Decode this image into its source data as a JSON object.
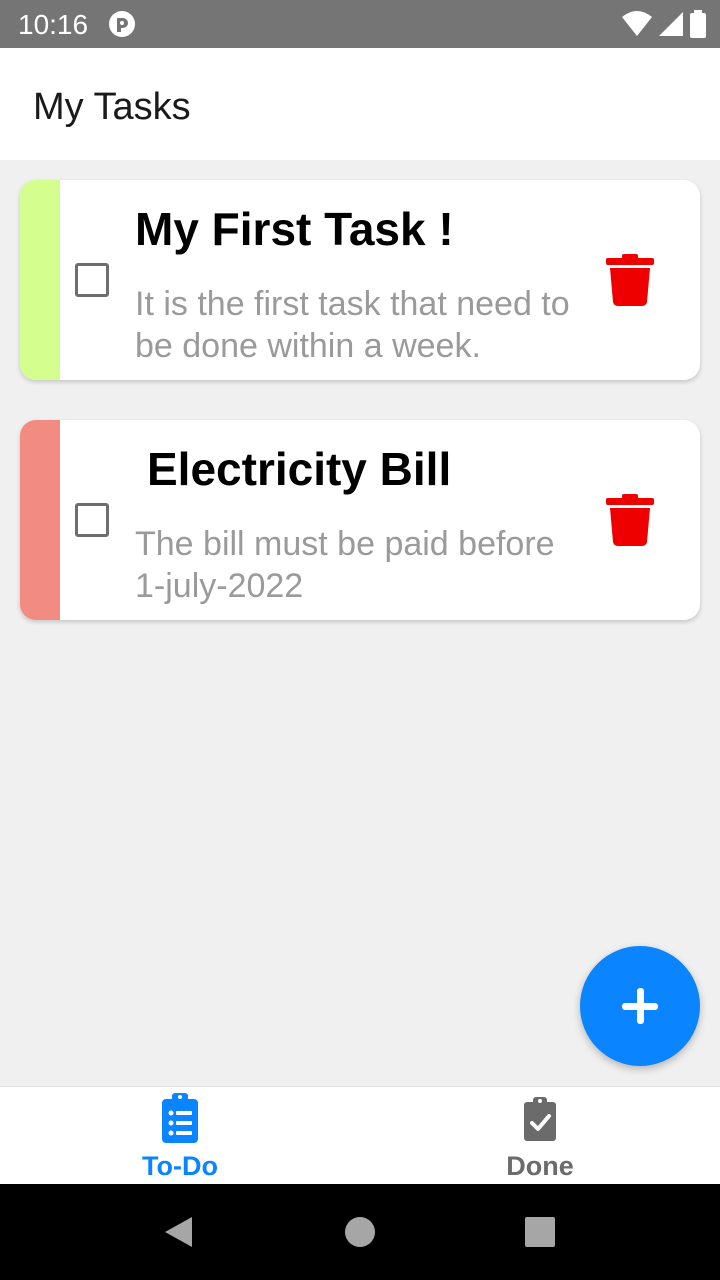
{
  "status_bar": {
    "time": "10:16",
    "icons": [
      "app-notification-icon",
      "wifi-icon",
      "cell-signal-icon",
      "battery-icon"
    ]
  },
  "app_bar": {
    "title": "My Tasks"
  },
  "tasks": [
    {
      "title": "My First Task !",
      "description": "It is the first task that need to be done within a week.",
      "checked": false,
      "stripe_color": "#d4ff8f"
    },
    {
      "title": "Electricity Bill",
      "description": "The bill must be paid before 1-july-2022",
      "checked": false,
      "stripe_color": "#f28b82"
    }
  ],
  "fab": {
    "icon": "plus-icon",
    "color": "#0a84ff"
  },
  "bottom_nav": {
    "tabs": [
      {
        "label": "To-Do",
        "icon": "clipboard-list-icon",
        "active": true
      },
      {
        "label": "Done",
        "icon": "clipboard-check-icon",
        "active": false
      }
    ],
    "active_color": "#0a84ff",
    "inactive_color": "#6b6b6b"
  },
  "system_nav": {
    "icons": [
      "back-icon",
      "home-icon",
      "recents-icon"
    ]
  },
  "colors": {
    "delete": "#ee0000",
    "background": "#f0f0f0"
  }
}
